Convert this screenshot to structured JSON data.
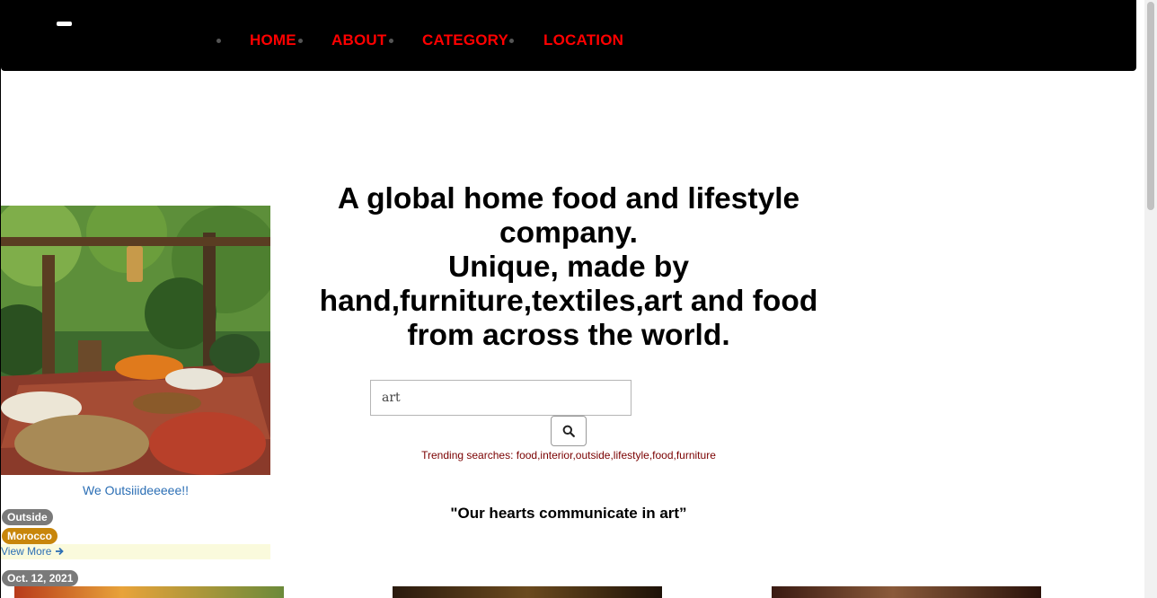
{
  "nav": {
    "links": [
      "HOME",
      "ABOUT",
      "CATEGORY",
      "LOCATION"
    ],
    "link_color": "#ff0000",
    "background": "#000000"
  },
  "hero": {
    "heading_line1": "A global home food and lifestyle company.",
    "heading_line2": "Unique, made by hand,furniture,textiles,art and food from across the world."
  },
  "search": {
    "value": "art",
    "button_icon": "search-icon"
  },
  "trending": {
    "text": "Trending searches: food,interior,outside,lifestyle,food,furniture"
  },
  "quote": {
    "text": "\"Our hearts communicate in art”"
  },
  "card": {
    "title": "We Outsiiideeeee!!",
    "tags": [
      "Outside",
      "Morocco"
    ],
    "view_more": "View More",
    "date": "Oct. 12, 2021"
  }
}
